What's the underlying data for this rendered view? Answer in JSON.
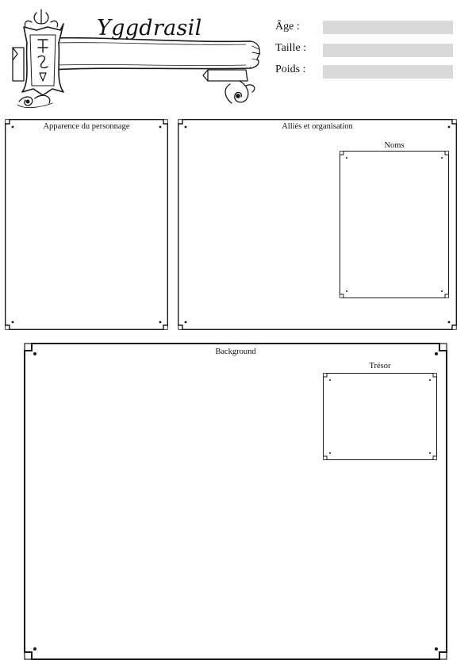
{
  "header": {
    "title": "Yggdrasil"
  },
  "fields": [
    {
      "label": "Âge :",
      "value": ""
    },
    {
      "label": "Taille :",
      "value": ""
    },
    {
      "label": "Poids :",
      "value": ""
    }
  ],
  "sections": {
    "appearance": {
      "title": "Apparence du personnage"
    },
    "allies": {
      "title": "Alliés et organisation",
      "names": {
        "title": "Noms"
      }
    },
    "background": {
      "title": "Background",
      "treasure": {
        "title": "Trésor"
      }
    }
  },
  "colors": {
    "ink": "#1a1a1a",
    "field_fill": "#d9d9d9",
    "paper": "#ffffff"
  }
}
